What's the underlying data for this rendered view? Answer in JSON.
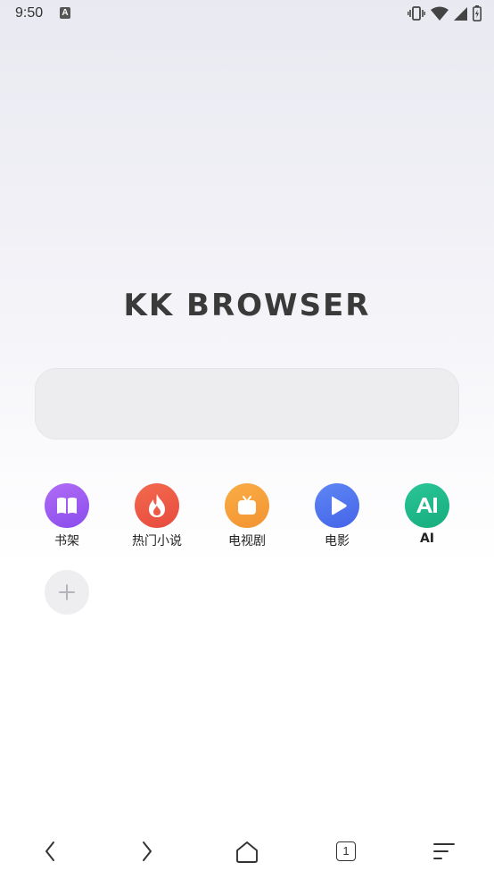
{
  "status_bar": {
    "time": "9:50",
    "notification_badge": "A",
    "icons": [
      "vibrate-icon",
      "wifi-icon",
      "signal-icon",
      "battery-icon"
    ]
  },
  "app": {
    "title": "KK BROWSER"
  },
  "search": {
    "placeholder": ""
  },
  "shortcuts": [
    {
      "label": "书架",
      "icon": "book-icon",
      "color": "#9b5bf0"
    },
    {
      "label": "热门小说",
      "icon": "flame-icon",
      "color": "#ef5a45"
    },
    {
      "label": "电视剧",
      "icon": "tv-icon",
      "color": "#f7a23a"
    },
    {
      "label": "电影",
      "icon": "play-icon",
      "color": "#4f72f0"
    },
    {
      "label": "AI",
      "icon": "ai-icon",
      "color": "#21b888"
    }
  ],
  "bottom_bar": {
    "tab_count": "1",
    "icons": [
      "back-icon",
      "forward-icon",
      "home-icon",
      "tabs-icon",
      "menu-icon"
    ]
  }
}
